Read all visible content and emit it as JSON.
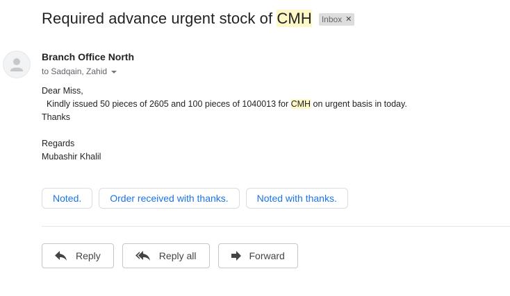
{
  "subject": {
    "text_before": "Required advance urgent stock of ",
    "highlight": "CMH",
    "label": "Inbox"
  },
  "sender": {
    "name": "Branch Office North",
    "to_line": "to Sadqain, Zahid"
  },
  "body": {
    "greeting": "Dear Miss,",
    "line2_before": "  Kindly issued 50 pieces of 2605 and 100 pieces of 1040013 for ",
    "line2_highlight": "CMH",
    "line2_after": " on urgent basis in today.",
    "thanks": "Thanks",
    "regards": "Regards",
    "signature": "Mubashir Khalil"
  },
  "smart_replies": [
    "Noted.",
    "Order received with thanks.",
    "Noted with thanks."
  ],
  "actions": {
    "reply": "Reply",
    "reply_all": "Reply all",
    "forward": "Forward"
  },
  "colors": {
    "highlight": "#fef7c6",
    "link_blue": "#1a73e8",
    "chip_bg": "#dddddd"
  },
  "icons": {
    "avatar": "person-icon",
    "label_close": "close-icon",
    "recipients_toggle": "chevron-down-icon",
    "reply": "reply-arrow-icon",
    "reply_all": "reply-all-arrow-icon",
    "forward": "forward-arrow-icon"
  }
}
